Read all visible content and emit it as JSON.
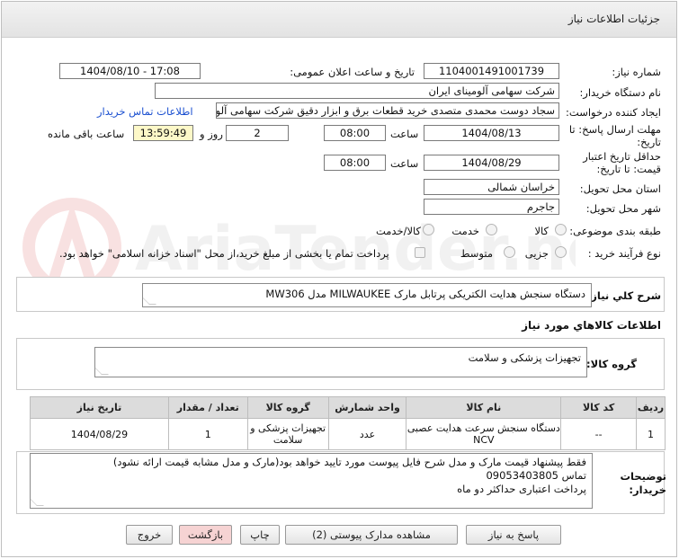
{
  "header": {
    "title": "جزئیات اطلاعات نیاز"
  },
  "form": {
    "need_number_label": "شماره نیاز:",
    "need_number": "1104001491001739",
    "announce_label": "تاریخ و ساعت اعلان عمومی:",
    "announce_value": "1404/08/10 - 17:08",
    "buyer_org_label": "نام دستگاه خریدار:",
    "buyer_org": "شرکت سهامی آلومینای ایران",
    "creator_label": "ایجاد کننده درخواست:",
    "creator": "سجاد دوست محمدی متصدی خرید قطعات برق و ابزار دقیق شرکت سهامی آلود",
    "contact_link": "اطلاعات تماس خریدار",
    "deadline_label": "مهلت ارسال پاسخ: تا تاریخ:",
    "deadline_date": "1404/08/13",
    "time_label": "ساعت",
    "deadline_time": "08:00",
    "days_count": "2",
    "days_label": "روز و",
    "remaining_time": "13:59:49",
    "remaining_label": "ساعت باقی مانده",
    "validity_label": "حداقل تاریخ اعتبار قیمت: تا تاریخ:",
    "validity_date": "1404/08/29",
    "validity_time": "08:00",
    "province_label": "استان محل تحویل:",
    "province": "خراسان شمالی",
    "city_label": "شهر محل تحویل:",
    "city": "جاجرم",
    "category_label": "طبقه بندی موضوعی:",
    "category_options": [
      "کالا",
      "خدمت",
      "کالا/خدمت"
    ],
    "process_label": "نوع فرآیند خرید :",
    "process_options": [
      "جزیی",
      "متوسط"
    ],
    "payment_note": "پرداخت تمام یا بخشی از مبلغ خرید،از محل \"اسناد خزانه اسلامی\" خواهد بود."
  },
  "summary": {
    "label": "شرح کلي نياز:",
    "value": "دستگاه سنجش هدایت الکتریکی پرتابل مارک MILWAUKEE مدل MW306"
  },
  "goods": {
    "section_title": "اطلاعات کالاهاي مورد نياز",
    "group_label": "گروه کالا:",
    "group_value": "تجهیزات پزشکی و سلامت",
    "columns": [
      "ردیف",
      "کد کالا",
      "نام کالا",
      "واحد شمارش",
      "گروه کالا",
      "تعداد / مقدار",
      "تاریخ نیاز"
    ],
    "rows": [
      [
        "1",
        "--",
        "دستگاه سنجش سرعت هدایت عصبی NCV",
        "عدد",
        "تجهیزات پزشکی و سلامت",
        "1",
        "1404/08/29"
      ]
    ]
  },
  "notes": {
    "label": "توضیحات خریدار:",
    "lines": [
      "فقط پیشنهاد قیمت مارک و مدل شرح فایل پیوست مورد تایید خواهد بود(مارک و مدل مشابه قیمت ارائه نشود)",
      "تماس 09053403805",
      "پرداخت اعتباری حداکثر دو ماه"
    ]
  },
  "buttons": {
    "reply": "پاسخ به نیاز",
    "attachments": "مشاهده مدارک پیوستی (2)",
    "print": "چاپ",
    "back": "بازگشت",
    "exit": "خروج"
  },
  "watermark_text": "AriaTender.neT",
  "colors": {
    "remaining_bg": "#fdf8c8",
    "link": "#1a4fd0",
    "back_btn": "#f6d3d3"
  }
}
